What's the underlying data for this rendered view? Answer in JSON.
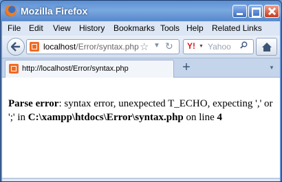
{
  "window": {
    "title": "Mozilla Firefox"
  },
  "menu": [
    "File",
    "Edit",
    "View",
    "History",
    "Bookmarks",
    "Tools",
    "Help",
    "Related Links"
  ],
  "nav": {
    "url_host": "localhost",
    "url_rest": "/Error/syntax.php",
    "search_placeholder": "Yahoo"
  },
  "tab": {
    "title": "http://localhost/Error/syntax.php",
    "new_tab": "+"
  },
  "error": {
    "label": "Parse error",
    "text1": ": syntax error, unexpected T_ECHO, expecting ',' or ';' in ",
    "path": "C:\\xampp\\htdocs\\Error\\syntax.php",
    "text2": " on line ",
    "line": "4"
  },
  "colors": {
    "titlebar": "#5d8fd2",
    "menubar": "#dce6f4",
    "accent": "#f06a23"
  },
  "icons": [
    "firefox-logo",
    "back-arrow-icon",
    "site-icon",
    "bookmark-star-icon",
    "dropdown-icon",
    "reload-icon",
    "yahoo-icon",
    "search-icon",
    "home-icon"
  ]
}
